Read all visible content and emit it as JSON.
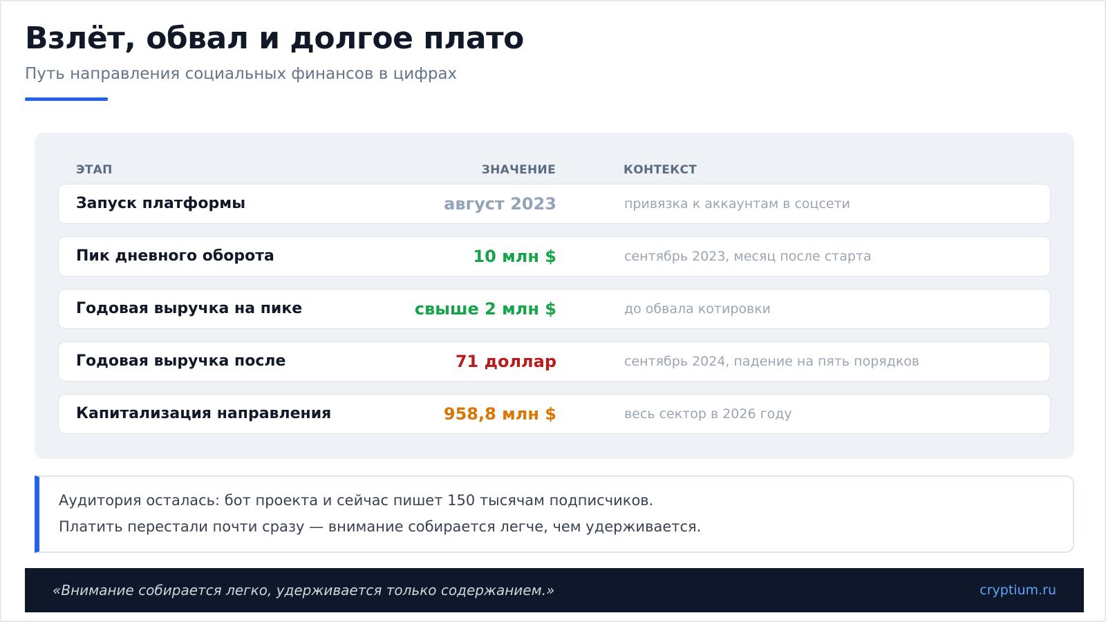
{
  "header": {
    "title": "Взлёт, обвал и долгое плато",
    "subtitle": "Путь направления социальных финансов в цифрах"
  },
  "table": {
    "columns": {
      "stage": "ЭТАП",
      "value": "ЗНАЧЕНИЕ",
      "context": "КОНТЕКСТ"
    },
    "rows": [
      {
        "stage": "Запуск платформы",
        "value": "август 2023",
        "context": "привязка к аккаунтам в соцсети",
        "value_color": "#94a3b8"
      },
      {
        "stage": "Пик дневного оборота",
        "value": "10 млн $",
        "context": "сентябрь 2023, месяц после старта",
        "value_color": "#16a34a"
      },
      {
        "stage": "Годовая выручка на пике",
        "value": "свыше 2 млн $",
        "context": "до обвала котировки",
        "value_color": "#16a34a"
      },
      {
        "stage": "Годовая выручка после",
        "value": "71 доллар",
        "context": "сентябрь 2024, падение на пять порядков",
        "value_color": "#b91c1c"
      },
      {
        "stage": "Капитализация направления",
        "value": "958,8 млн $",
        "context": "весь сектор в 2026 году",
        "value_color": "#d97706"
      }
    ]
  },
  "note": {
    "line1": "Аудитория осталась: бот проекта и сейчас пишет 150 тысячам подписчиков.",
    "line2": "Платить перестали почти сразу — внимание собирается легче, чем удерживается."
  },
  "footer": {
    "quote": "«Внимание собирается легко, удерживается только содержанием.»",
    "site": "cryptium.ru"
  },
  "colors": {
    "accent": "#2563eb",
    "panel_bg": "#eef1f5",
    "footer_bg": "#0f172a",
    "link": "#60a5fa"
  }
}
